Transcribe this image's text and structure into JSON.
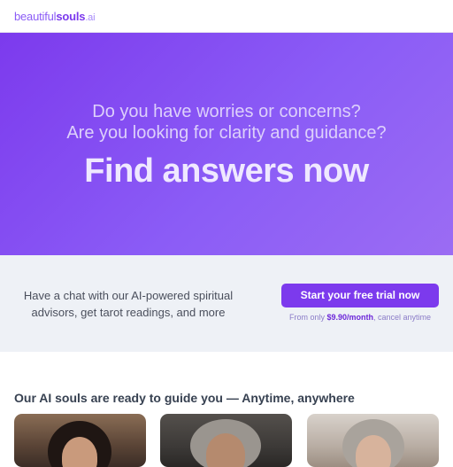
{
  "brand": {
    "logo_part1": "beautiful",
    "logo_part2": "souls",
    "logo_part3": ".ai"
  },
  "hero": {
    "question1": "Do you have worries or concerns?",
    "question2": "Are you looking for clarity and guidance?",
    "headline": "Find answers now"
  },
  "cta": {
    "description": "Have a chat with our AI-powered spiritual advisors, get tarot readings, and more",
    "button_label": "Start your free trial now",
    "price_prefix": "From only ",
    "price_amount": "$9.90/month",
    "price_suffix": ", cancel anytime"
  },
  "souls": {
    "title": "Our AI souls are ready to guide you — Anytime, anywhere"
  },
  "colors": {
    "accent": "#7c3aed",
    "hero_gradient_start": "#7c3aed",
    "hero_gradient_end": "#9b6cf3",
    "cta_band_bg": "#eef1f6"
  }
}
